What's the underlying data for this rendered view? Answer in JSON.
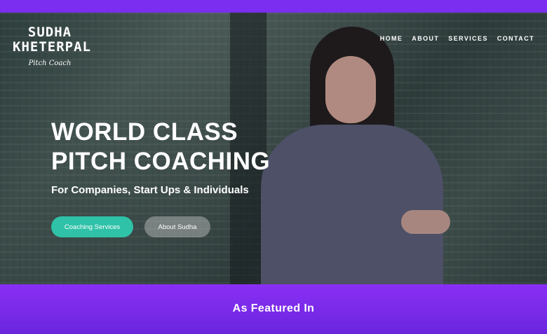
{
  "brand": {
    "name_line1": "SUDHA",
    "name_line2": "KHETERPAL",
    "tagline": "Pitch Coach"
  },
  "nav": {
    "items": [
      "HOME",
      "ABOUT",
      "SERVICES",
      "CONTACT"
    ]
  },
  "hero": {
    "title_line1": "WORLD CLASS",
    "title_line2": "PITCH COACHING",
    "subtitle": "For Companies, Start Ups & Individuals",
    "primary_button": "Coaching Services",
    "secondary_button": "About Sudha"
  },
  "featured": {
    "title": "As Featured In"
  },
  "colors": {
    "accent_purple": "#7b2df0",
    "button_teal": "#2fc2a8"
  }
}
